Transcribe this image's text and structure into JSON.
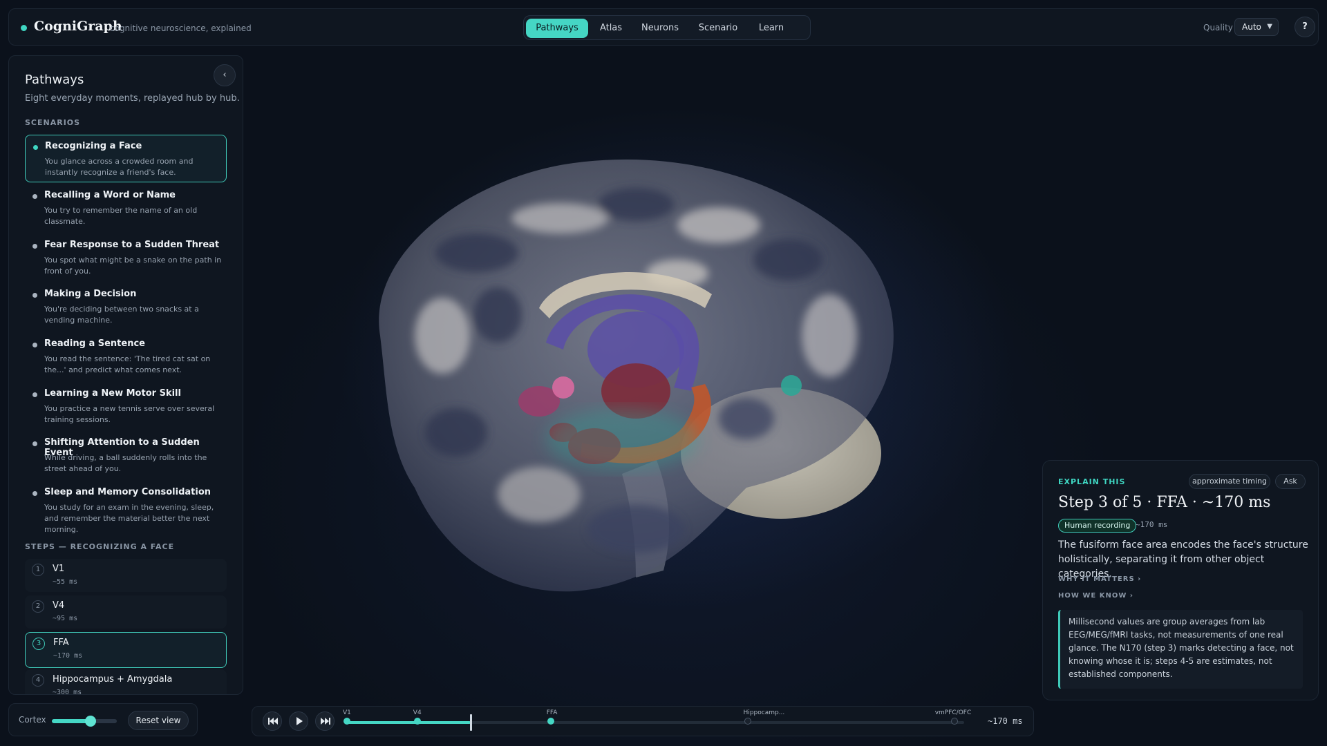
{
  "app": {
    "name": "CogniGraph",
    "tagline": "cognitive neuroscience, explained"
  },
  "nav": {
    "tabs": [
      {
        "label": "Pathways",
        "active": true
      },
      {
        "label": "Atlas",
        "active": false
      },
      {
        "label": "Neurons",
        "active": false
      },
      {
        "label": "Scenario",
        "active": false
      },
      {
        "label": "Learn",
        "active": false
      }
    ]
  },
  "quality": {
    "label": "Quality",
    "value": "Auto"
  },
  "help": {
    "label": "?"
  },
  "panel": {
    "title": "Pathways",
    "subtitle": "Eight everyday moments, replayed hub by hub.",
    "collapse_glyph": "‹",
    "scenarios_label": "SCENARIOS",
    "scenarios": [
      {
        "title": "Recognizing a Face",
        "desc": "You glance across a crowded room and instantly recognize a friend's face.",
        "active": true
      },
      {
        "title": "Recalling a Word or Name",
        "desc": "You try to remember the name of an old classmate."
      },
      {
        "title": "Fear Response to a Sudden Threat",
        "desc": "You spot what might be a snake on the path in front of you."
      },
      {
        "title": "Making a Decision",
        "desc": "You're deciding between two snacks at a vending machine."
      },
      {
        "title": "Reading a Sentence",
        "desc": "You read the sentence: 'The tired cat sat on the...' and predict what comes next."
      },
      {
        "title": "Learning a New Motor Skill",
        "desc": "You practice a new tennis serve over several training sessions."
      },
      {
        "title": "Shifting Attention to a Sudden Event",
        "desc": "While driving, a ball suddenly rolls into the street ahead of you."
      },
      {
        "title": "Sleep and Memory Consolidation",
        "desc": "You study for an exam in the evening, sleep, and remember the material better the next morning."
      }
    ],
    "steps_label": "STEPS — RECOGNIZING A FACE",
    "steps": [
      {
        "num": "1",
        "name": "V1",
        "time": "~55 ms"
      },
      {
        "num": "2",
        "name": "V4",
        "time": "~95 ms"
      },
      {
        "num": "3",
        "name": "FFA",
        "time": "~170 ms",
        "active": true
      },
      {
        "num": "4",
        "name": "Hippocampus + Amygdala",
        "time": "~300 ms"
      }
    ]
  },
  "cortex": {
    "label": "Cortex",
    "value": 0.6,
    "reset_label": "Reset view"
  },
  "timeline": {
    "markers": [
      {
        "label": "V1",
        "pos": 0.0,
        "done": true
      },
      {
        "label": "V4",
        "pos": 0.114,
        "done": true
      },
      {
        "label": "FFA",
        "pos": 0.33,
        "done": true
      },
      {
        "label": "Hippocamp...",
        "pos": 0.649,
        "done": false
      },
      {
        "label": "vmPFC/OFC",
        "pos": 0.984,
        "done": false
      }
    ],
    "progress": 0.2,
    "time": "~170 ms"
  },
  "explain": {
    "label": "EXPLAIN THIS",
    "chip_timing": "approximate timing",
    "chip_ask": "Ask",
    "title": "Step 3 of 5 · FFA · ~170 ms",
    "badge": "Human recording",
    "time": "~170 ms",
    "body": "The fusiform face area encodes the face's structure holistically, separating it from other object categories.",
    "why_label": "WHY IT MATTERS ›",
    "how_label": "HOW WE KNOW ›",
    "note": "Millisecond values are group averages from lab EEG/MEG/fMRI tasks, not measurements of one real glance. The N170 (step 3) marks detecting a face, not knowing whose it is; steps 4-5 are estimates, not established components."
  },
  "colors": {
    "accent": "#45d6c4",
    "panel_bg": "#0f1620",
    "page_bg": "#0b111b"
  }
}
